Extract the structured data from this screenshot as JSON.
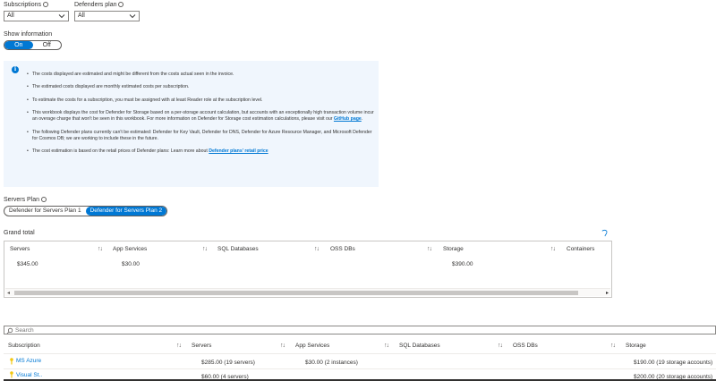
{
  "filters": {
    "subscriptions_label": "Subscriptions",
    "subscriptions_value": "All",
    "defenders_plan_label": "Defenders plan",
    "defenders_plan_value": "All"
  },
  "show_information": {
    "label": "Show information",
    "on": "On",
    "off": "Off"
  },
  "info": {
    "items": [
      "The costs displayed are estimated and might be different from the costs actual seen in the invoice.",
      "The estimated costs displayed are monthly estimated costs per subscription.",
      "To estimate the costs for a subscription, you must be assigned with at least Reader role at the subscription level.",
      "The following Defender plans currently can't be estimated: Defender for Key Vault, Defender for DNS, Defender for Azure Resource Manager, and Microsoft Defender for Cosmos DB; we are working to include these in the future."
    ],
    "storage_text": "This workbook displays the cost for Defender for Storage based on a per-storage account calculation, but accounts with an exceptionally high transaction volume incur an overage charge that won't be seen in this workbook. For more information on Defender for Storage cost estimation calculations, please visit our ",
    "storage_link": "GitHub page",
    "retail_text": "The cost estimation is based on the retail prices of Defender plans: Learn more about ",
    "retail_link": "Defender plans' retail price"
  },
  "servers_plan": {
    "label": "Servers Plan",
    "option1": "Defender for Servers Plan 1",
    "option2": "Defender for Servers Plan 2"
  },
  "grand_total": {
    "title": "Grand total",
    "columns": [
      "Servers",
      "App Services",
      "SQL Databases",
      "OSS DBs",
      "Storage",
      "Containers"
    ],
    "row": {
      "servers": "$345.00",
      "app_services": "$30.00",
      "storage": "$390.00"
    }
  },
  "search": {
    "placeholder": "Search"
  },
  "subscriptions_table": {
    "columns": [
      "Subscription",
      "Servers",
      "App Services",
      "SQL Databases",
      "OSS DBs",
      "Storage"
    ],
    "rows": [
      {
        "name": "MS Azure",
        "servers": "$285.00 (19 servers)",
        "app_services": "$30.00 (2 instances)",
        "storage": "$190.00 (19 storage accounts)"
      },
      {
        "name": "Visual St..",
        "servers": "$60.00 (4 servers)",
        "app_services": "",
        "storage": "$200.00 (20 storage accounts)"
      }
    ]
  },
  "colors": {
    "accent": "#0078d4",
    "info_bg": "#f0f6fd",
    "key_icon": "#f2c811"
  }
}
